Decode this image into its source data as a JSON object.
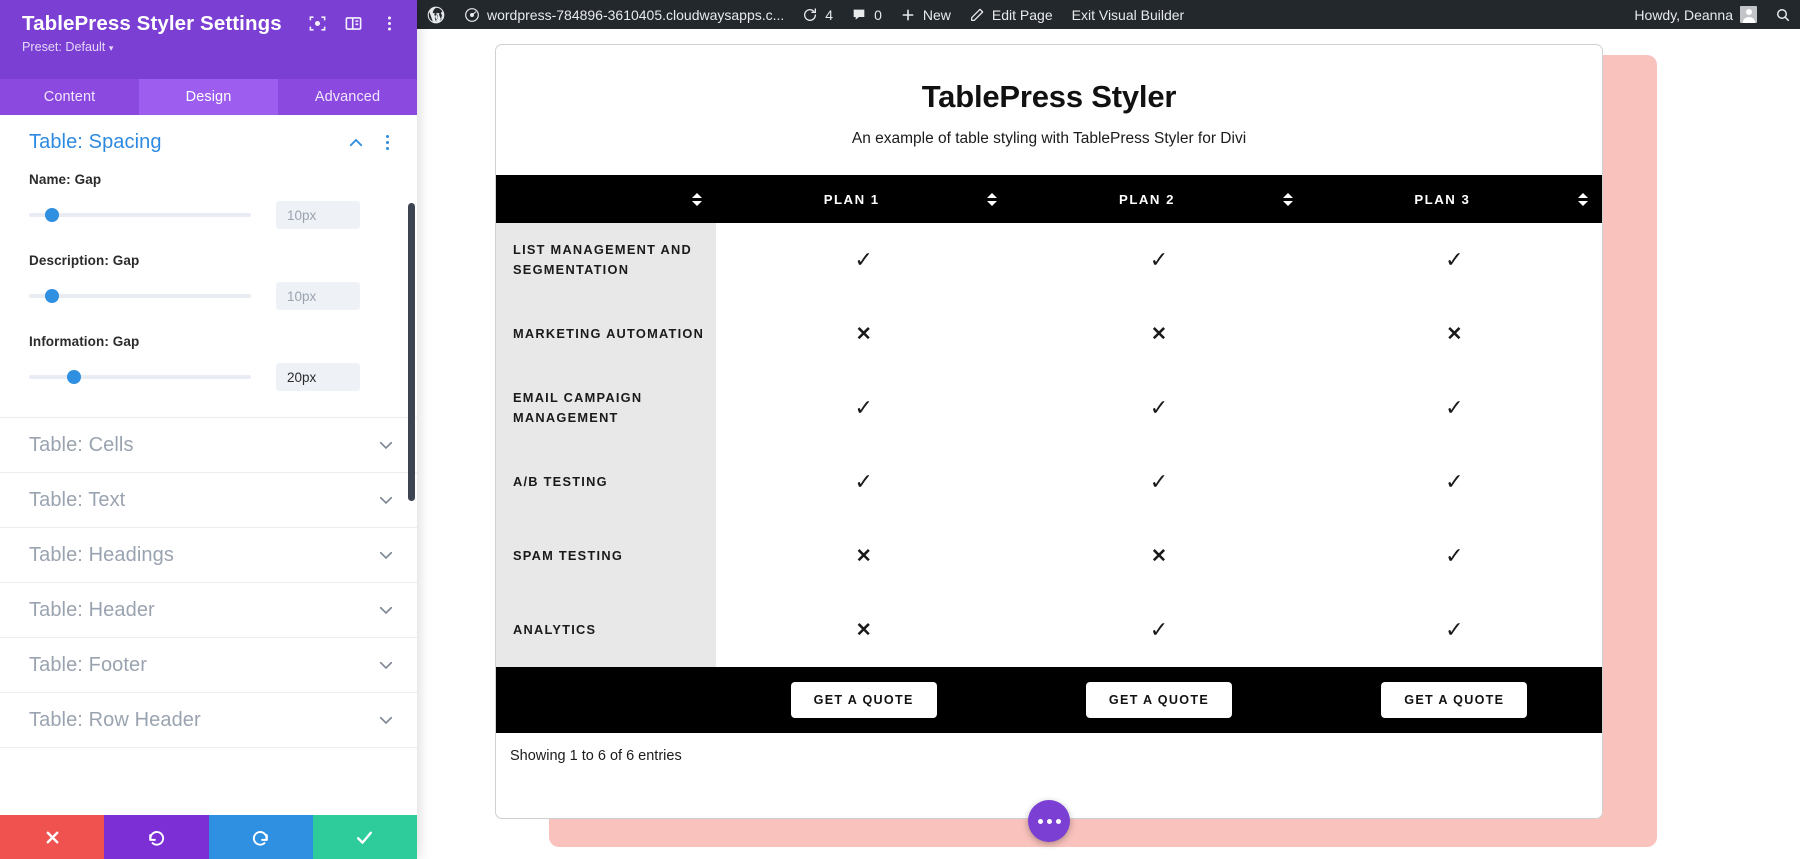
{
  "settings_panel": {
    "title": "TablePress Styler Settings",
    "preset_label": "Preset: Default",
    "header_icons": [
      {
        "name": "focus-target-icon"
      },
      {
        "name": "layout-columns-icon"
      },
      {
        "name": "kebab-menu-icon"
      }
    ],
    "tabs": [
      {
        "id": "content",
        "label": "Content",
        "active": false
      },
      {
        "id": "design",
        "label": "Design",
        "active": true
      },
      {
        "id": "advanced",
        "label": "Advanced",
        "active": false
      }
    ],
    "open_group": {
      "title": "Table: Spacing",
      "fields": [
        {
          "label": "Name: Gap",
          "value": "10px",
          "slider_percent": 10,
          "filled": false
        },
        {
          "label": "Description: Gap",
          "value": "10px",
          "slider_percent": 10,
          "filled": false
        },
        {
          "label": "Information: Gap",
          "value": "20px",
          "slider_percent": 21,
          "filled": true
        }
      ]
    },
    "collapsed_groups": [
      {
        "title": "Table: Cells"
      },
      {
        "title": "Table: Text"
      },
      {
        "title": "Table: Headings"
      },
      {
        "title": "Table: Header"
      },
      {
        "title": "Table: Footer"
      },
      {
        "title": "Table: Row Header"
      }
    ],
    "actions": [
      {
        "id": "cancel",
        "name": "cancel-button",
        "icon": "close-icon",
        "color": "#f0534f"
      },
      {
        "id": "undo",
        "name": "undo-button",
        "icon": "undo-icon",
        "color": "#7b2fd4"
      },
      {
        "id": "redo",
        "name": "redo-button",
        "icon": "redo-icon",
        "color": "#2f8fe0"
      },
      {
        "id": "save",
        "name": "save-button",
        "icon": "check-icon",
        "color": "#2ecc9a"
      }
    ]
  },
  "admin_bar": {
    "site_name": "wordpress-784896-3610405.cloudwaysapps.c...",
    "updates_count": "4",
    "comments_count": "0",
    "new_label": "New",
    "edit_page_label": "Edit Page",
    "exit_builder_label": "Exit Visual Builder",
    "howdy_label": "Howdy, Deanna"
  },
  "table_card": {
    "title": "TablePress Styler",
    "subtitle": "An example of table styling with TablePress Styler for Divi",
    "columns": [
      "",
      "Plan 1",
      "Plan 2",
      "Plan 3"
    ],
    "rows": [
      {
        "feature": "List Management and Segmentation",
        "values": [
          "yes",
          "yes",
          "yes"
        ]
      },
      {
        "feature": "Marketing Automation",
        "values": [
          "no",
          "no",
          "no"
        ]
      },
      {
        "feature": "Email Campaign Management",
        "values": [
          "yes",
          "yes",
          "yes"
        ]
      },
      {
        "feature": "A/B Testing",
        "values": [
          "yes",
          "yes",
          "yes"
        ]
      },
      {
        "feature": "Spam Testing",
        "values": [
          "no",
          "no",
          "yes"
        ]
      },
      {
        "feature": "Analytics",
        "values": [
          "no",
          "yes",
          "yes"
        ]
      }
    ],
    "footer_buttons": [
      "Get a Quote",
      "Get a Quote",
      "Get a Quote"
    ],
    "info_text": "Showing 1 to 6 of 6 entries",
    "yes_glyph": "✓",
    "no_glyph": "✕"
  },
  "colors": {
    "brand_purple": "#7b3fd4",
    "tab_active": "#9d5ef0",
    "accent_blue": "#2d8ae0",
    "slider_blue": "#2f8fe0",
    "table_black": "#000000",
    "row_header_bg": "#e8e8e8",
    "shadow_pink": "#f9c2bc",
    "adminbar_bg": "#23282d"
  }
}
